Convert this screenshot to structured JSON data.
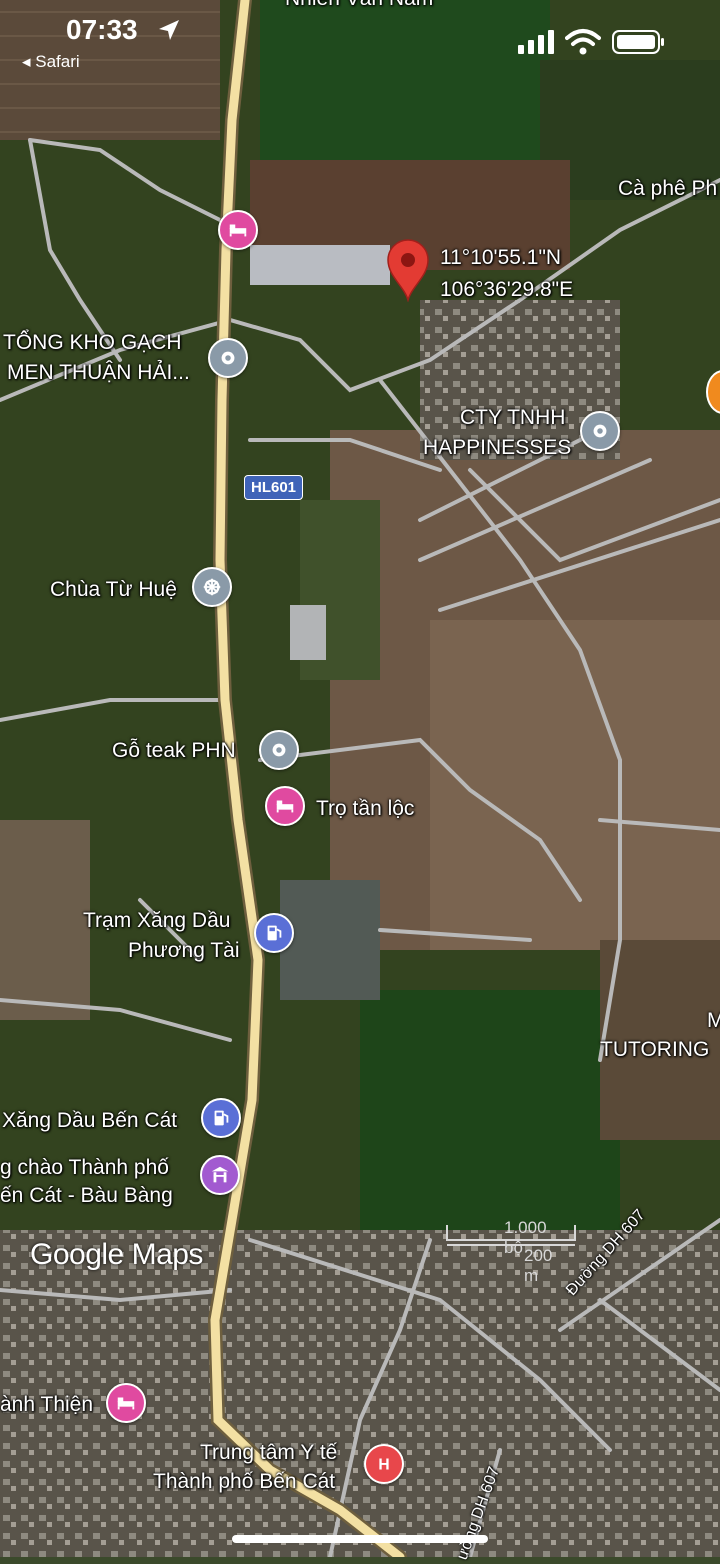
{
  "status_bar": {
    "time": "07:33",
    "back_label": "◂ Safari"
  },
  "marker": {
    "lat": "11°10'55.1\"N",
    "lng": "106°36'29.8\"E"
  },
  "road_badge": "HL601",
  "labels": {
    "top_road": "Nhiễn Văn Nam",
    "cafe": "Cà phê Ph",
    "warehouse_line1": "TỔNG KHO GẠCH",
    "warehouse_line2": "MEN THUẬN HẢI...",
    "cty_line1": "CTY TNHH",
    "cty_line2": "HAPPINESSES",
    "pagoda": "Chùa Từ Huệ",
    "teak": "Gỗ teak PHN",
    "motel": "Trọ tần lộc",
    "gas1_line1": "Trạm Xăng Dầu",
    "gas1_line2": "Phương Tài",
    "tutoring": "TUTORING",
    "tutoring_m": "M",
    "gas2": "Xăng Dầu Bến Cát",
    "gate_line1": "g chào Thành phố",
    "gate_line2": "ến Cát - Bàu Bàng",
    "thien": "ành Thiện",
    "hospital_line1": "Trung tâm Y tế",
    "hospital_line2": "Thành phố Bến Cát",
    "road_dh607_a": "Đường DH 607",
    "road_dh607_b": "ường DH 607"
  },
  "scale": {
    "feet": "1.000 bộ",
    "meters": "200 m"
  },
  "logo": "Google Maps",
  "colors": {
    "lodging_pin": "#e04aa0",
    "place_pin": "#8a9aa8",
    "gas_pin": "#5a6fd6",
    "landmark_pin": "#a25ad0",
    "hospital_pin": "#e8474b",
    "marker_red": "#e33b33",
    "main_road": "#f3e0a3",
    "side_road": "#b9b9b9"
  }
}
